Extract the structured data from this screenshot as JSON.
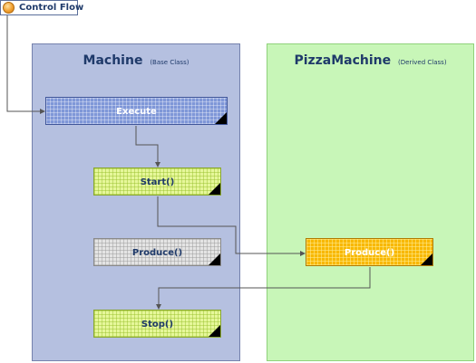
{
  "legend": {
    "label": "Control Flow",
    "icon": "orange-circle-icon"
  },
  "base_panel": {
    "title": "Machine",
    "subtitle": "(Base Class)",
    "color": "#b5c0e0"
  },
  "derived_panel": {
    "title": "PizzaMachine",
    "subtitle": "(Derived Class)",
    "color": "#c8f6b8"
  },
  "boxes": {
    "execute": {
      "label": "Execute"
    },
    "start": {
      "label": "Start()"
    },
    "produce_base": {
      "label": "Produce()"
    },
    "stop": {
      "label": "Stop()"
    },
    "produce_derived": {
      "label": "Produce()"
    }
  },
  "colors": {
    "arrow": "#555555",
    "title": "#1f3a6a",
    "execute_fill": "#7f97d8",
    "lime_fill": "#e6f79a",
    "grey_fill": "#e4e4e4",
    "orange_fill": "#f8b800"
  }
}
